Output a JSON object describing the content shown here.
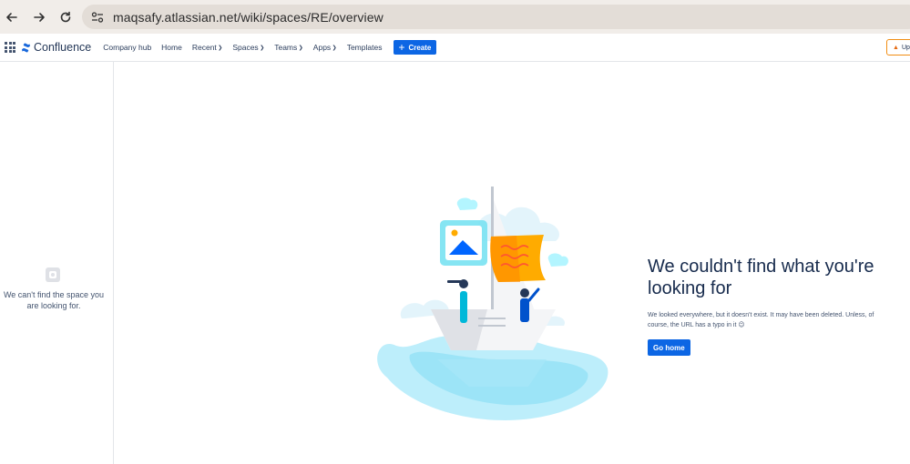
{
  "browser": {
    "url": "maqsafy.atlassian.net/wiki/spaces/RE/overview",
    "back_icon": "arrow-left-icon",
    "forward_icon": "arrow-right-icon",
    "reload_icon": "reload-icon"
  },
  "header": {
    "product_name": "Confluence",
    "nav": {
      "company_hub": "Company hub",
      "home": "Home",
      "recent": "Recent",
      "spaces": "Spaces",
      "teams": "Teams",
      "apps": "Apps",
      "templates": "Templates"
    },
    "create_label": "Create",
    "upgrade_label": "Up",
    "accent_color": "#0c66e4"
  },
  "sidebar": {
    "message": "We can't find the space you are looking for."
  },
  "main": {
    "title": "We couldn't find what you're looking for",
    "description": "We looked everywhere, but it doesn't exist. It may have been deleted. Unless, of course, the URL has a typo in it 😉",
    "go_home_label": "Go home"
  }
}
